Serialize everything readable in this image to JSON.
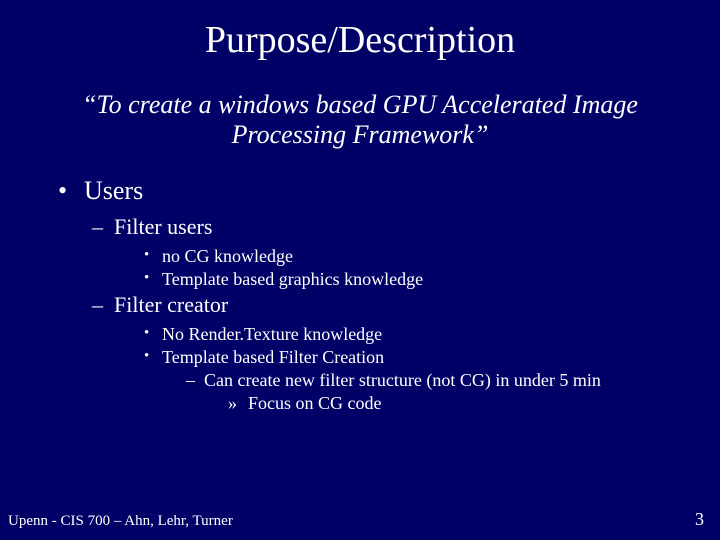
{
  "title": "Purpose/Description",
  "quote": "“To create a windows based GPU Accelerated Image Processing Framework”",
  "bullets": {
    "users": "Users",
    "filter_users": "Filter users",
    "no_cg": "no CG knowledge",
    "tmpl_graphics": "Template based graphics knowledge",
    "filter_creator": "Filter creator",
    "no_render": "No Render.Texture knowledge",
    "tmpl_filter": "Template based Filter Creation",
    "can_create": "Can create new filter structure (not CG) in under 5 min",
    "focus": "Focus on CG code"
  },
  "footer": {
    "left": "Upenn - CIS 700 – Ahn, Lehr, Turner",
    "page": "3"
  }
}
